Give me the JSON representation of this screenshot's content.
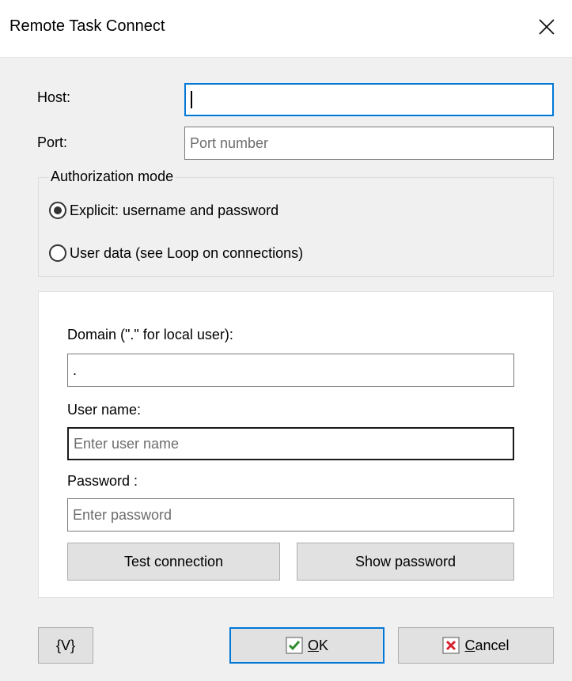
{
  "window": {
    "title": "Remote Task Connect"
  },
  "host": {
    "label": "Host:",
    "value": ""
  },
  "port": {
    "label": "Port:",
    "placeholder": "Port number"
  },
  "auth": {
    "caption": "Authorization mode",
    "options": [
      {
        "label": "Explicit: username and password",
        "selected": true
      },
      {
        "label": "User data (see Loop on connections)",
        "selected": false
      }
    ]
  },
  "credentials": {
    "domain_label": "Domain (\".\" for local user):",
    "domain_value": ".",
    "username_label": "User name:",
    "username_placeholder": "Enter user name",
    "password_label": "Password :",
    "password_placeholder": "Enter password",
    "test_button": "Test connection",
    "show_button": "Show password"
  },
  "footer": {
    "variables_button": "{V}",
    "ok_first": "O",
    "ok_rest": "K",
    "cancel_first": "C",
    "cancel_rest": "ancel"
  },
  "icons": {
    "close": "close-icon",
    "ok": "checkmark-icon",
    "cancel": "x-mark-icon"
  },
  "colors": {
    "focus_border": "#0078d7",
    "check_green": "#2e8b2e",
    "cancel_red": "#d9232e"
  }
}
